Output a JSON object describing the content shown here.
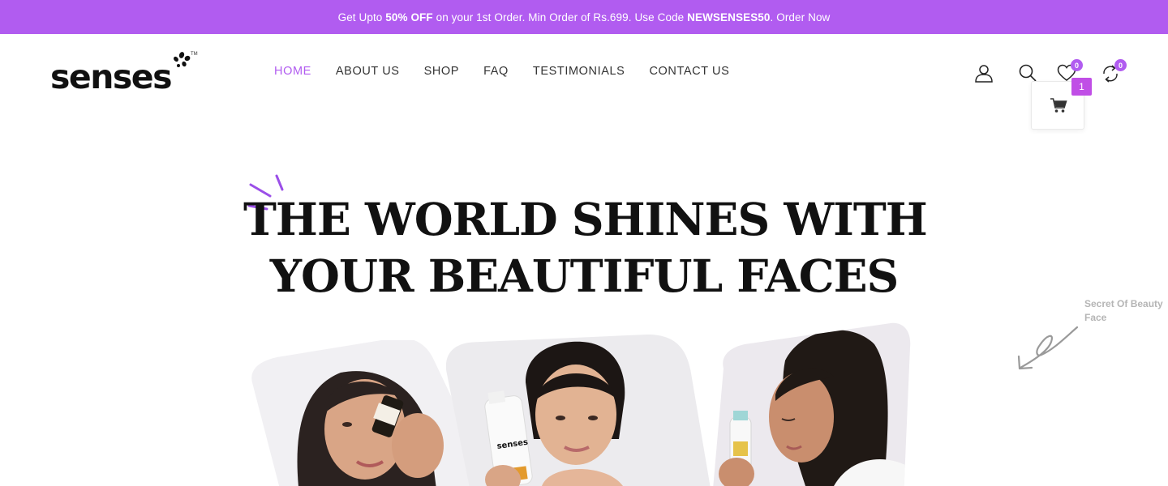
{
  "promo": {
    "prefix": "Get Upto ",
    "discount": "50% OFF",
    "middle": " on your 1st Order. Min Order of Rs.699. Use Code ",
    "code": "NEWSENSES50",
    "suffix": ". Order Now"
  },
  "brand": {
    "logo_text": "senses",
    "trademark": "TM"
  },
  "nav": {
    "items": [
      {
        "label": "HOME",
        "active": true
      },
      {
        "label": "ABOUT US",
        "active": false
      },
      {
        "label": "SHOP",
        "active": false
      },
      {
        "label": "FAQ",
        "active": false
      },
      {
        "label": "TESTIMONIALS",
        "active": false
      },
      {
        "label": "CONTACT US",
        "active": false
      }
    ]
  },
  "header_icons": {
    "account": "user-icon",
    "search": "search-icon",
    "wishlist": {
      "icon": "heart-icon",
      "count": "0"
    },
    "compare": {
      "icon": "compare-icon",
      "count": "0"
    },
    "cart": {
      "icon": "cart-icon",
      "count": "1"
    }
  },
  "hero": {
    "title_line1": "THE WORLD SHINES WITH",
    "title_line2": "YOUR BEAUTIFUL FACES",
    "side_note": "Secret Of Beauty Face",
    "product_label": "senses"
  },
  "colors": {
    "accent": "#b15cf0",
    "cart_badge": "#c04ee6",
    "text": "#111111",
    "nav_text": "#333333",
    "muted": "#b5b5b5"
  }
}
